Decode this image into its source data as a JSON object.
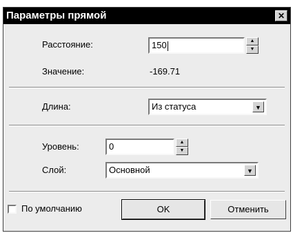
{
  "dialog": {
    "title": "Параметры прямой",
    "close_glyph": "✕"
  },
  "distance": {
    "label": "Расстояние:",
    "value": "150"
  },
  "value_row": {
    "label": "Значение:",
    "value": "-169.71"
  },
  "length": {
    "label": "Длина:",
    "selected": "Из статуса"
  },
  "level": {
    "label": "Уровень:",
    "value": "0"
  },
  "layer": {
    "label": "Слой:",
    "selected": "Основной"
  },
  "default_check": {
    "label": "По умолчанию",
    "checked": false
  },
  "buttons": {
    "ok": "OK",
    "cancel": "Отменить"
  },
  "icons": {
    "spin_up": "▲",
    "spin_down": "▼",
    "dropdown": "▼"
  }
}
